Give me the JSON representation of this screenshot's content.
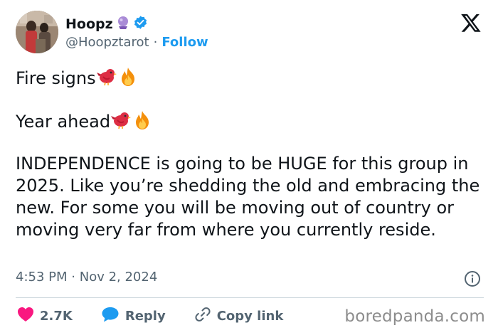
{
  "author": {
    "name": "Hoopz",
    "handle": "@Hoopztarot",
    "separator": "·",
    "follow_label": "Follow",
    "name_emoji": "crystal-ball-icon",
    "verified": true
  },
  "tweet": {
    "line1": "Fire signs",
    "line2": "Year ahead",
    "paragraph": "INDEPENDENCE is going to be HUGE for this group in 2025. Like you’re shedding the old and embracing the new. For some you will be moving out of country or moving very far from where you currently reside.",
    "emojis": [
      "red-bird-icon",
      "fire-icon"
    ]
  },
  "meta": {
    "time": "4:53 PM",
    "separator": "·",
    "date": "Nov 2, 2024"
  },
  "actions": {
    "like_count": "2.7K",
    "reply_label": "Reply",
    "copy_label": "Copy link"
  },
  "watermark": "boredpanda.com",
  "colors": {
    "accent": "#1d9bf0",
    "like": "#f91880",
    "text": "#0f1419",
    "muted": "#536471"
  }
}
